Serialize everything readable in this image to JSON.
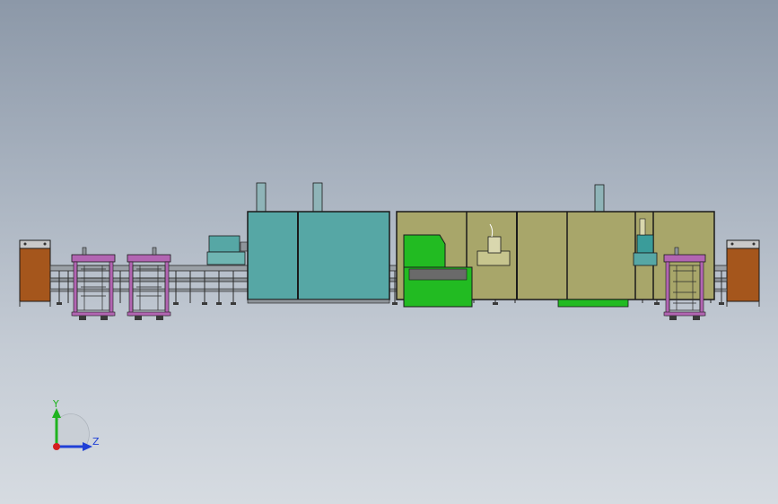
{
  "viewport": {
    "background_top": "#8c98a8",
    "background_bottom": "#d6dbe1"
  },
  "triad": {
    "x_label": "",
    "y_label": "Y",
    "z_label": "Z",
    "y_color": "#1fb31f",
    "z_color": "#1f3fd6",
    "origin_color": "#d41f1f"
  },
  "colors": {
    "cabinet_brown": "#a5561c",
    "teal_enclosure": "#56a7a5",
    "olive_enclosure": "#a8a66a",
    "green_guard": "#22bb22",
    "magenta_frame": "#b265b2",
    "conveyor_gray": "#8e949a",
    "outline": "#1a1a1a"
  }
}
